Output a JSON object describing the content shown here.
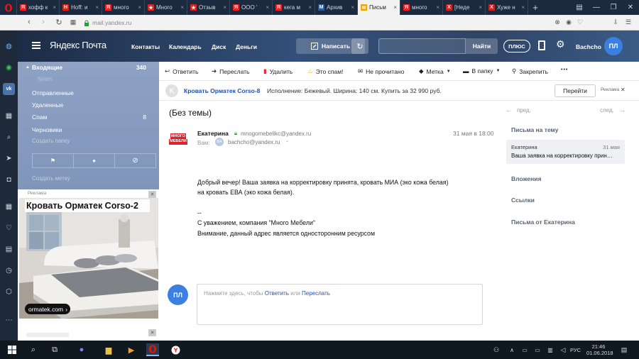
{
  "browser": {
    "tabs": [
      {
        "title": "хофф к",
        "icon": "yandex-tab-icon",
        "color": "#e22",
        "glyph": "Я"
      },
      {
        "title": "Hoff: и",
        "icon": "hoff-tab-icon",
        "color": "#d21",
        "glyph": "H"
      },
      {
        "title": "много",
        "icon": "yandex-tab-icon",
        "color": "#e22",
        "glyph": "Я"
      },
      {
        "title": "Много",
        "icon": "star-tab-icon",
        "color": "#d22",
        "glyph": "★"
      },
      {
        "title": "Отзыв",
        "icon": "star-tab-icon",
        "color": "#d22",
        "glyph": "★"
      },
      {
        "title": "ООО '",
        "icon": "yandex-tab-icon",
        "color": "#e22",
        "glyph": "Я"
      },
      {
        "title": "кега м",
        "icon": "yandex-tab-icon",
        "color": "#e22",
        "glyph": "Я"
      },
      {
        "title": "Архив",
        "icon": "m-tab-icon",
        "color": "#2a5aa0",
        "glyph": "M"
      },
      {
        "title": "Письм",
        "icon": "mail-tab-icon",
        "color": "#f5a000",
        "glyph": "✉",
        "active": true
      },
      {
        "title": "много",
        "icon": "yandex-tab-icon",
        "color": "#e22",
        "glyph": "Я"
      },
      {
        "title": "[Неде",
        "icon": "x-tab-icon",
        "color": "#c22",
        "glyph": "X"
      },
      {
        "title": "Хуже н",
        "icon": "x-tab-icon",
        "color": "#c22",
        "glyph": "X"
      }
    ],
    "new_tab": "+",
    "url": "mail.yandex.ru"
  },
  "header": {
    "logo": "Яндекс Почта",
    "nav": [
      "Контакты",
      "Календарь",
      "Диск",
      "Деньги"
    ],
    "compose": "Написать",
    "search_button": "Найти",
    "plus": "ПЛЮС",
    "username": "Bachcho",
    "avatar": "ПЛ"
  },
  "folders": {
    "inbox": "Входящие",
    "inbox_count": "340",
    "sub": "Notes",
    "sent": "Отправленные",
    "deleted": "Удаленные",
    "spam": "Спам",
    "spam_count": "8",
    "drafts": "Черновики",
    "create_folder": "Создать папку",
    "create_label": "Создать метку"
  },
  "ad": {
    "label": "Реклама",
    "title": "Кровать Орматек Corso-2",
    "domain": "ormatek.com",
    "arrow": "›",
    "close": "✕"
  },
  "toolbar": {
    "reply": "Ответить",
    "forward": "Переслать",
    "delete": "Удалить",
    "spam": "Это спам!",
    "unread": "Не прочитано",
    "label": "Метка",
    "to_folder": "В папку",
    "pin": "Закрепить",
    "more": "•••"
  },
  "adline": {
    "title": "Кровать Орматек Corso-8",
    "text": "Исполнение: Бежевый. Ширина: 140 см. Купить за 32 990 руб.",
    "button": "Перейти",
    "label": "Реклама",
    "close": "✕",
    "k": "K"
  },
  "message": {
    "subject": "(Без темы)",
    "sender_name": "Екатерина",
    "sender_email": "mnogomebelikc@yandex.ru",
    "date": "31 мая в 18:00",
    "to_label": "Вам:",
    "to_avatar": "BA",
    "to_email": "bachcho@yandex.ru",
    "logo_line1": "МНОГО",
    "logo_line2": "МЕБЕЛИ",
    "body": [
      "Добрый вечер! Ваша заявка на корректировку принята, кровать МИА (эко кожа белая)",
      "на кровать ЕВА (эко кожа белая).",
      "",
      "--",
      "С уважением, компания \"Много Мебели\"",
      "Внимание, данный адрес является односторонним ресурсом"
    ]
  },
  "reply": {
    "avatar": "ПЛ",
    "prefix": "Нажмите здесь, чтобы ",
    "reply_link": "Ответить",
    "or": " или ",
    "forward_link": "Переслать"
  },
  "right": {
    "prev": "пред.",
    "next": "след.",
    "thread_title": "Письма на тему",
    "thread_sender": "Екатерина",
    "thread_date": "31 мая",
    "thread_subject": "Ваша заявка на корректировку прин…",
    "attachments": "Вложения",
    "links": "Ссылки",
    "from_sender": "Письма от Екатерина"
  },
  "taskbar": {
    "lang": "РУС",
    "time": "21:46",
    "date": "01.06.2018"
  }
}
